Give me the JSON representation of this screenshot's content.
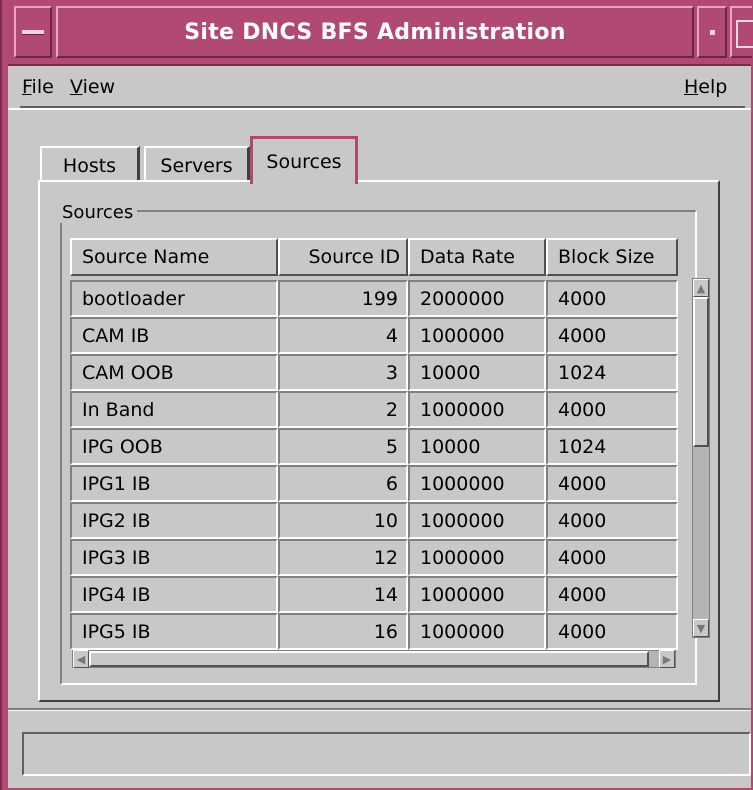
{
  "window": {
    "title": "Site DNCS BFS Administration"
  },
  "menu": {
    "file": {
      "mnemonic": "F",
      "rest": "ile"
    },
    "view": {
      "mnemonic": "V",
      "rest": "iew"
    },
    "help": {
      "mnemonic": "H",
      "rest": "elp"
    }
  },
  "tabs": [
    {
      "label": "Hosts",
      "active": false
    },
    {
      "label": "Servers",
      "active": false
    },
    {
      "label": "Sources",
      "active": true
    }
  ],
  "group_label": "Sources",
  "table": {
    "columns": [
      "Source Name",
      "Source ID",
      "Data Rate",
      "Block Size"
    ],
    "rows": [
      [
        "bootloader",
        "199",
        "2000000",
        "4000"
      ],
      [
        "CAM IB",
        "4",
        "1000000",
        "4000"
      ],
      [
        "CAM OOB",
        "3",
        "10000",
        "1024"
      ],
      [
        "In Band",
        "2",
        "1000000",
        "4000"
      ],
      [
        "IPG OOB",
        "5",
        "10000",
        "1024"
      ],
      [
        "IPG1 IB",
        "6",
        "1000000",
        "4000"
      ],
      [
        "IPG2 IB",
        "10",
        "1000000",
        "4000"
      ],
      [
        "IPG3 IB",
        "12",
        "1000000",
        "4000"
      ],
      [
        "IPG4 IB",
        "14",
        "1000000",
        "4000"
      ],
      [
        "IPG5 IB",
        "16",
        "1000000",
        "4000"
      ]
    ]
  },
  "status": {
    "text": ""
  }
}
